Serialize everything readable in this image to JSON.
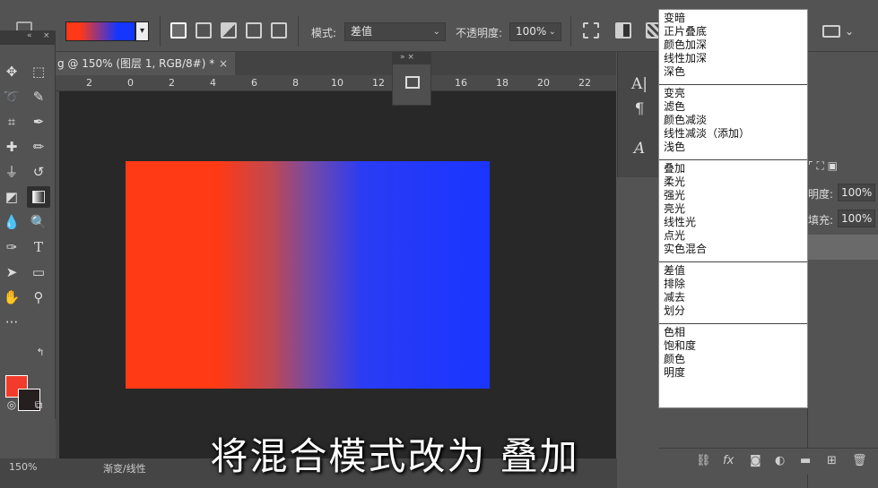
{
  "options_bar": {
    "mode_label": "模式:",
    "mode_value": "差值",
    "opacity_label": "不透明度:",
    "opacity_value": "100%"
  },
  "document": {
    "tab_title": "g @ 150% (图层 1, RGB/8#) *",
    "close": "×",
    "ruler_ticks": [
      "2",
      "0",
      "2",
      "4",
      "6",
      "8",
      "10",
      "12",
      "14",
      "16",
      "18",
      "20",
      "22"
    ],
    "zoom": "150%",
    "status_text": "渐变/线性"
  },
  "right_panel": {
    "opacity_label": "明度:",
    "opacity_value": "100%",
    "fill_label": "填充:",
    "fill_value": "100%"
  },
  "blend_menu": {
    "groups": [
      [
        "变暗",
        "正片叠底",
        "颜色加深",
        "线性加深",
        "深色"
      ],
      [
        "变亮",
        "滤色",
        "颜色减淡",
        "线性减淡（添加）",
        "浅色"
      ],
      [
        "叠加",
        "柔光",
        "强光",
        "亮光",
        "线性光",
        "点光",
        "实色混合"
      ],
      [
        "差值",
        "排除",
        "减去",
        "划分"
      ],
      [
        "色相",
        "饱和度",
        "颜色",
        "明度"
      ]
    ]
  },
  "subtitle": "将混合模式改为 叠加",
  "colors": {
    "foreground": "#f23b2a",
    "background": "#251f20",
    "gradient_start": "#ff3a14",
    "gradient_end": "#1a35ff"
  }
}
